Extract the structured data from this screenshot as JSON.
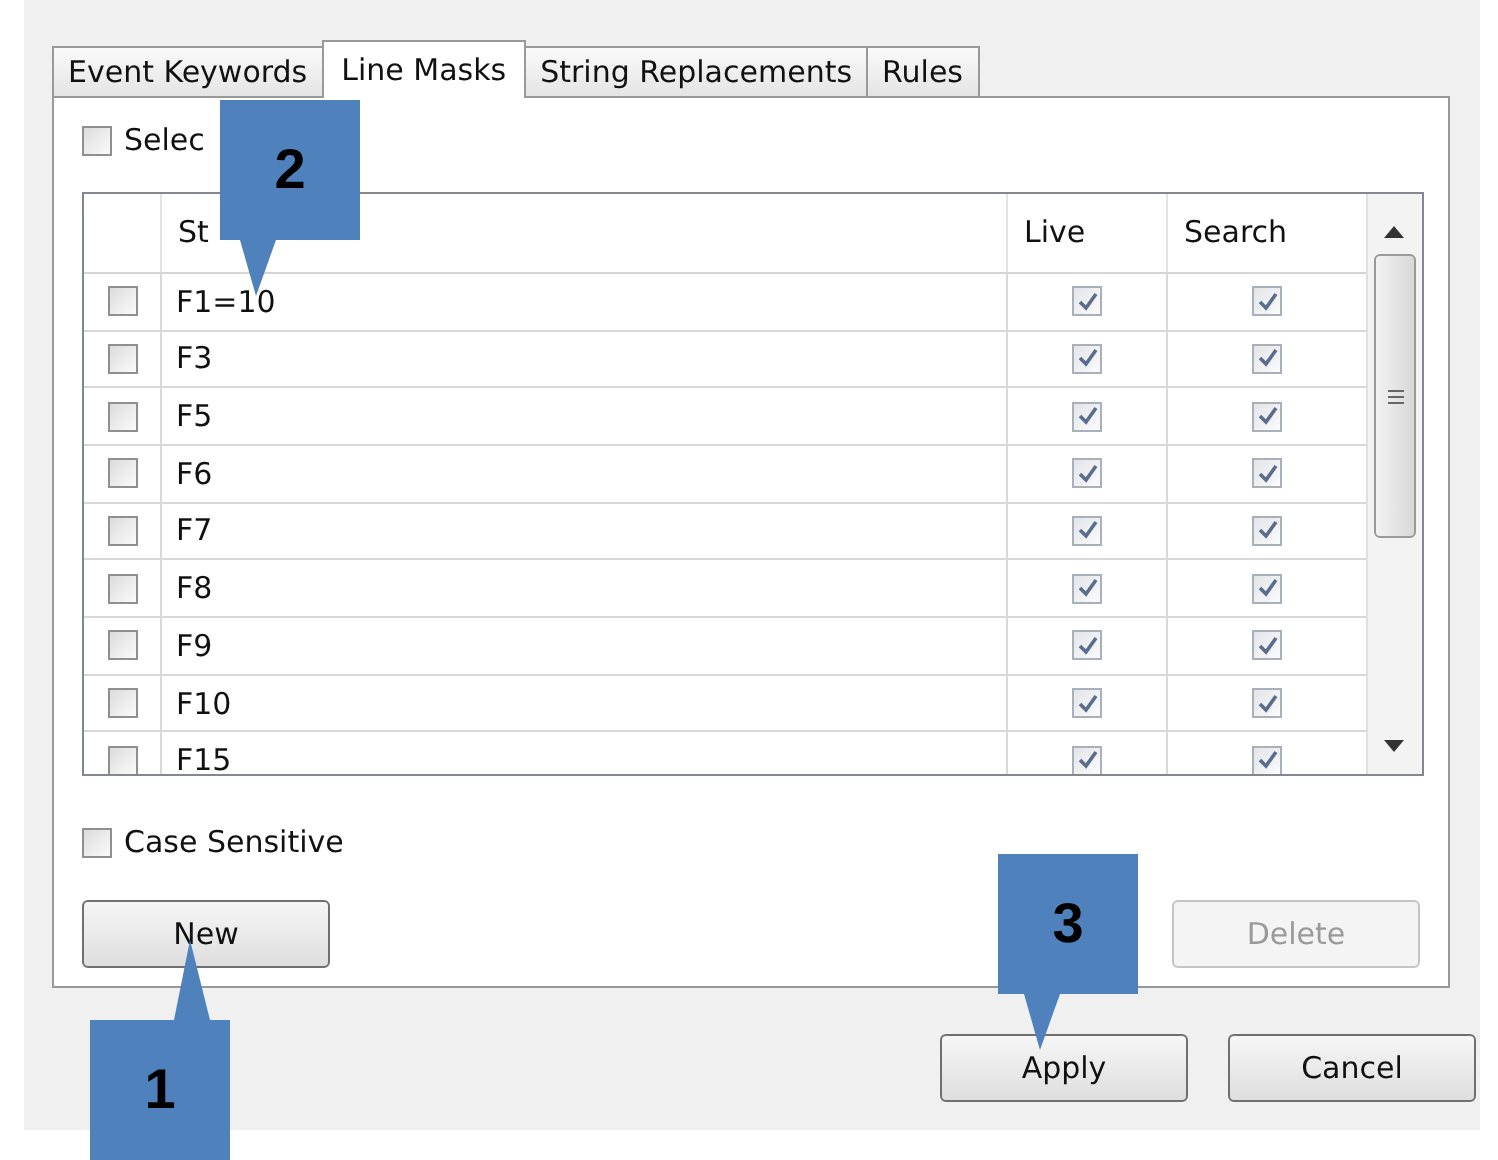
{
  "tabs": [
    {
      "label": "Event Keywords",
      "selected": false
    },
    {
      "label": "Line Masks",
      "selected": true
    },
    {
      "label": "String Replacements",
      "selected": false
    },
    {
      "label": "Rules",
      "selected": false
    }
  ],
  "select_all": {
    "label": "Selec",
    "checked": false
  },
  "grid": {
    "columns": [
      "St",
      "Live",
      "Search"
    ],
    "rows": [
      {
        "string": "F1=10",
        "checked": false,
        "live": true,
        "search": true
      },
      {
        "string": "F3",
        "checked": false,
        "live": true,
        "search": true
      },
      {
        "string": "F5",
        "checked": false,
        "live": true,
        "search": true
      },
      {
        "string": "F6",
        "checked": false,
        "live": true,
        "search": true
      },
      {
        "string": "F7",
        "checked": false,
        "live": true,
        "search": true
      },
      {
        "string": "F8",
        "checked": false,
        "live": true,
        "search": true
      },
      {
        "string": "F9",
        "checked": false,
        "live": true,
        "search": true
      },
      {
        "string": "F10",
        "checked": false,
        "live": true,
        "search": true
      },
      {
        "string": "F15",
        "checked": false,
        "live": true,
        "search": true
      }
    ]
  },
  "case_sensitive": {
    "label": "Case Sensitive",
    "checked": false
  },
  "new_button": {
    "label": "New",
    "disabled": false
  },
  "delete_button": {
    "label": "Delete",
    "disabled": true
  },
  "footer_buttons": [
    {
      "label": "Apply",
      "disabled": false
    },
    {
      "label": "Cancel",
      "disabled": false
    }
  ],
  "callouts": [
    {
      "number": "2",
      "kind": "down"
    },
    {
      "number": "1",
      "kind": "up"
    },
    {
      "number": "3",
      "kind": "down"
    }
  ]
}
